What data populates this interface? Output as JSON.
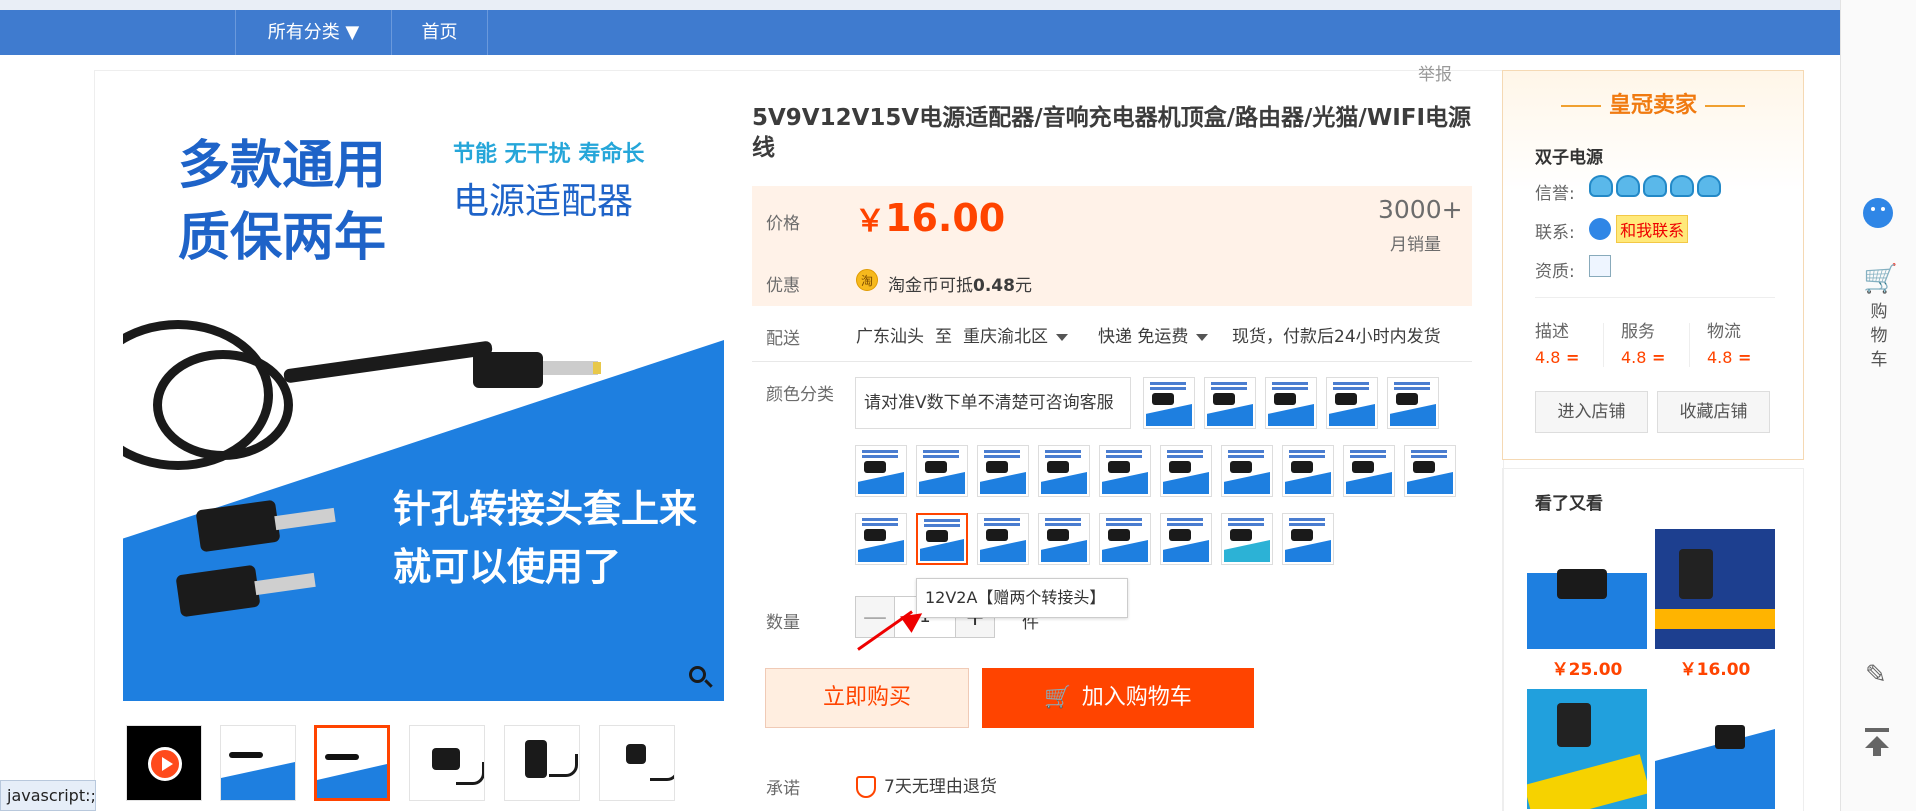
{
  "nav": {
    "all_categories": "所有分类 ▼",
    "home": "首页"
  },
  "report": "举报",
  "product": {
    "title": "5V9V12V15V电源适配器/音响充电器机顶盒/路由器/光猫/WIFI电源线",
    "main_image_text": {
      "headline_1": "多款通用",
      "headline_2": "质保两年",
      "tagline": "节能 无干扰 寿命长",
      "subtitle": "电源适配器",
      "bottom_1": "针孔转接头套上来",
      "bottom_2": "就可以使用了"
    },
    "price_label": "价格",
    "currency": "￥",
    "price": "16.00",
    "monthly_sales": "3000+",
    "monthly_sales_label": "月销量",
    "promo_label": "优惠",
    "coin_icon_text": "淘",
    "promo_prefix": "淘金币可抵",
    "promo_amount": "0.48",
    "promo_suffix": "元",
    "shipping_label": "配送",
    "ship_from": "广东汕头",
    "ship_to_word": "至",
    "ship_to": "重庆渝北区",
    "express": "快递 免运费",
    "delivery_note": "现货，付款后24小时内发货",
    "color_label": "颜色分类",
    "color_first_option": "请对准V数下单不清楚可咨询客服",
    "tooltip": "12V2A【赠两个转接头】",
    "qty_label": "数量",
    "qty_minus": "—",
    "qty_value": "1",
    "qty_plus": "+",
    "qty_unit": "件",
    "buy_now": "立即购买",
    "add_cart": "加入购物车",
    "cart_icon": "🛒",
    "promise_label": "承诺",
    "promise_text": "7天无理由退货"
  },
  "seller": {
    "level": "皇冠卖家",
    "name": "双子电源",
    "credit_label": "信誉:",
    "contact_label": "联系:",
    "contact_text": "和我联系",
    "qual_label": "资质:",
    "ratings": [
      {
        "label": "描述",
        "value": "4.8"
      },
      {
        "label": "服务",
        "value": "4.8"
      },
      {
        "label": "物流",
        "value": "4.8"
      }
    ],
    "enter_shop": "进入店铺",
    "favorite_shop": "收藏店铺"
  },
  "recommend": {
    "title": "看了又看",
    "items": [
      {
        "price": "￥25.00"
      },
      {
        "price": "￥16.00"
      }
    ]
  },
  "rightbar": {
    "cart_label": "购物车"
  },
  "status_bar": "javascript:;",
  "colors": {
    "accent": "#ff4400",
    "nav": "#3f7bcf",
    "price_bg": "#fff2e8"
  }
}
